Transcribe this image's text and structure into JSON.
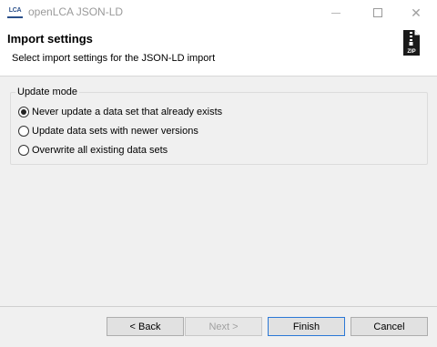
{
  "window": {
    "app_icon_text": "LCA",
    "title": "openLCA JSON-LD",
    "close_glyph": "✕"
  },
  "header": {
    "title": "Import settings",
    "description": "Select import settings for the JSON-LD import",
    "zip_icon_label": "ZIP",
    "icon": "zip-file-icon"
  },
  "update_mode": {
    "legend": "Update mode",
    "options": [
      {
        "label": "Never update a data set that already exists",
        "selected": true
      },
      {
        "label": "Update data sets with newer versions",
        "selected": false
      },
      {
        "label": "Overwrite all existing data sets",
        "selected": false
      }
    ]
  },
  "buttons": {
    "back": "< Back",
    "next": "Next >",
    "finish": "Finish",
    "cancel": "Cancel"
  },
  "colors": {
    "content_bg": "#f0f0f0",
    "focus_border": "#2b78d6",
    "disabled_text": "#a0a0a0"
  }
}
